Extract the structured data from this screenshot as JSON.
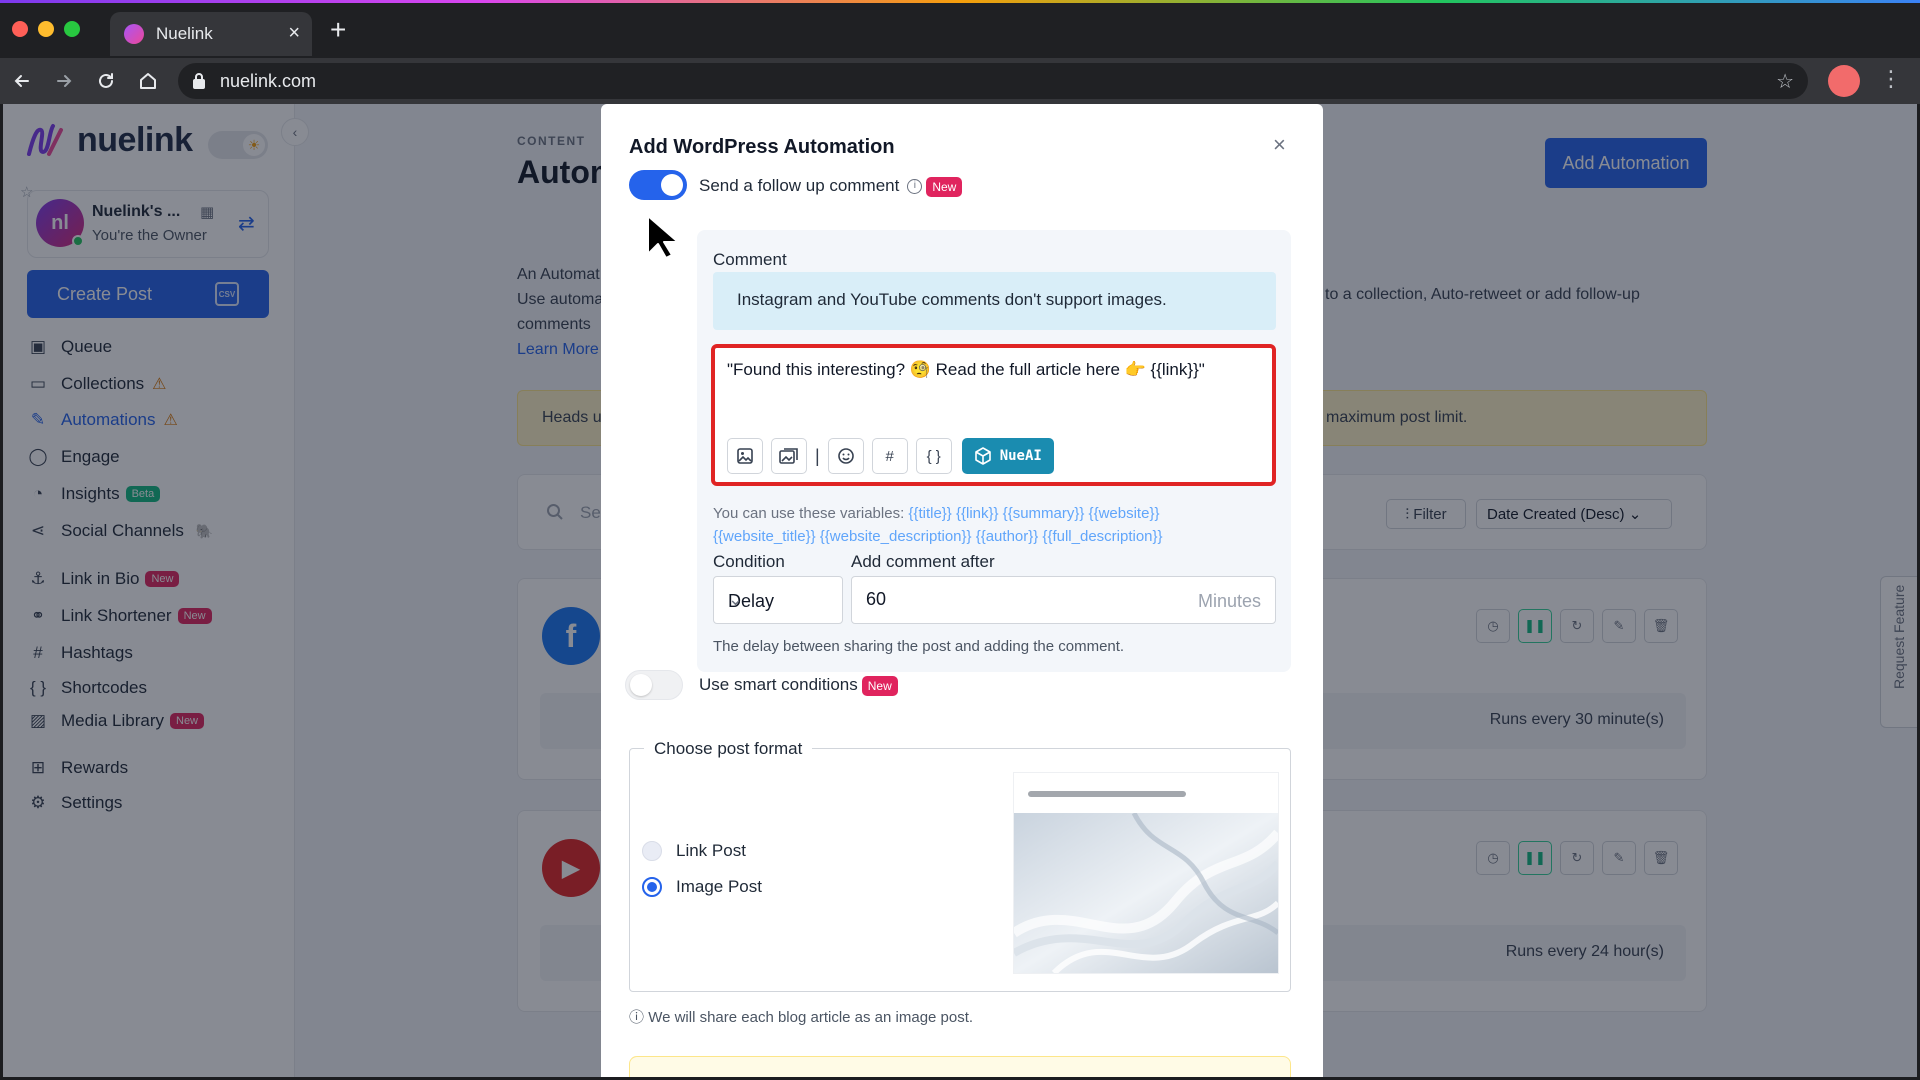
{
  "browser": {
    "tab_title": "Nuelink",
    "url": "nuelink.com",
    "traffic_colors": [
      "#ff5f57",
      "#febc2e",
      "#28c840"
    ]
  },
  "sidebar": {
    "logo_text": "nuelink",
    "account": {
      "name": "Nuelink's ...",
      "role": "You're the Owner",
      "initials": "nl"
    },
    "create_post_label": "Create Post",
    "csv_label": "CSV",
    "items": [
      {
        "label": "Queue",
        "icon": "calendar-icon"
      },
      {
        "label": "Collections",
        "icon": "folder-icon",
        "warning": true
      },
      {
        "label": "Automations",
        "icon": "magic-wand-icon",
        "warning": true,
        "active": true
      },
      {
        "label": "Engage",
        "icon": "chat-bubble-icon"
      },
      {
        "label": "Insights",
        "icon": "pie-chart-icon",
        "badge": "Beta"
      },
      {
        "label": "Social Channels",
        "icon": "share-icon",
        "emoji": "🐘"
      },
      {
        "label": "Link in Bio",
        "icon": "anchor-icon",
        "badge": "New"
      },
      {
        "label": "Link Shortener",
        "icon": "link-icon",
        "badge": "New"
      },
      {
        "label": "Hashtags",
        "icon": "hash-icon"
      },
      {
        "label": "Shortcodes",
        "icon": "braces-icon"
      },
      {
        "label": "Media Library",
        "icon": "images-icon",
        "badge": "New"
      },
      {
        "label": "Rewards",
        "icon": "gift-icon"
      },
      {
        "label": "Settings",
        "icon": "gear-icon"
      }
    ]
  },
  "main": {
    "breadcrumb": "CONTENT",
    "title": "Autom",
    "add_button": "Add Automation",
    "desc_lines": [
      "An Automat",
      "Use automa",
      "comments"
    ],
    "desc_right": "to a collection, Auto-retweet or add follow-up",
    "learn_more": "Learn More",
    "notice_left": "Heads u",
    "notice_right": "maximum post limit.",
    "search_placeholder": "Se",
    "filter_label": "Filter",
    "sort_label": "Date Created (Desc)",
    "cards": [
      {
        "network": "facebook",
        "color": "#1877f2",
        "runs": "Runs every 30 minute(s)"
      },
      {
        "network": "youtube",
        "color": "#e02424",
        "runs": "Runs every 24 hour(s)"
      }
    ],
    "request_feature": "Request Feature"
  },
  "modal": {
    "title": "Add WordPress Automation",
    "close": "×",
    "followup_toggle_label": "Send a follow up comment",
    "new_badge": "New",
    "comment_label": "Comment",
    "info_banner": "Instagram and YouTube comments don't support images.",
    "comment_text": "\"Found this interesting? 🧐 Read the full article here 👉 {{link}}\"",
    "nueai_label": "NueAI",
    "vars_intro": "You can use these variables:",
    "vars_line1": "{{title}} {{link}} {{summary}} {{website}}",
    "vars_line2": "{{website_title}} {{website_description}} {{author}} {{full_description}}",
    "condition_label": "Condition",
    "condition_value": "Delay",
    "after_label": "Add comment after",
    "after_value": "60",
    "after_unit": "Minutes",
    "delay_help": "The delay between sharing the post and adding the comment.",
    "smart_toggle_label": "Use smart conditions",
    "format_legend": "Choose post format",
    "format_options": [
      "Link Post",
      "Image Post"
    ],
    "format_selected": "Image Post",
    "format_help": "We will share each blog article as an image post."
  },
  "colors": {
    "primary": "#2563eb",
    "danger_outline": "#e02424",
    "badge_new": "#e0245e",
    "nueai": "#1a8cb0",
    "info_bg": "#d9eef8"
  }
}
